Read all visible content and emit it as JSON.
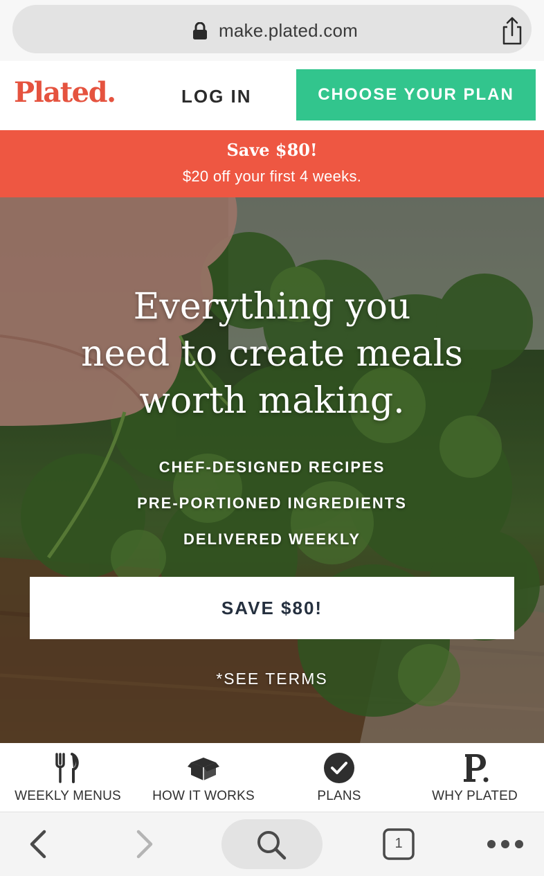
{
  "browser": {
    "url": "make.plated.com",
    "tab_count": "1"
  },
  "header": {
    "logo": "Plated.",
    "login": "LOG IN",
    "cta": "CHOOSE YOUR PLAN"
  },
  "promo": {
    "title": "Save $80!",
    "subtitle": "$20 off your first 4 weeks."
  },
  "hero": {
    "headline": [
      "Everything you",
      "need to create meals",
      "worth making."
    ],
    "features": [
      "CHEF-DESIGNED RECIPES",
      "PRE-PORTIONED INGREDIENTS",
      "DELIVERED WEEKLY"
    ],
    "button": "SAVE $80!",
    "terms": "*SEE TERMS"
  },
  "nav": [
    {
      "label": "WEEKLY MENUS",
      "icon": "utensils-icon"
    },
    {
      "label": "HOW IT WORKS",
      "icon": "box-icon"
    },
    {
      "label": "PLANS",
      "icon": "check-circle-icon"
    },
    {
      "label": "WHY PLATED",
      "icon": "plated-p-icon"
    }
  ],
  "colors": {
    "brand_red": "#e5533f",
    "promo_red": "#ee5742",
    "cta_green": "#32c58d",
    "button_text": "#25303f"
  }
}
